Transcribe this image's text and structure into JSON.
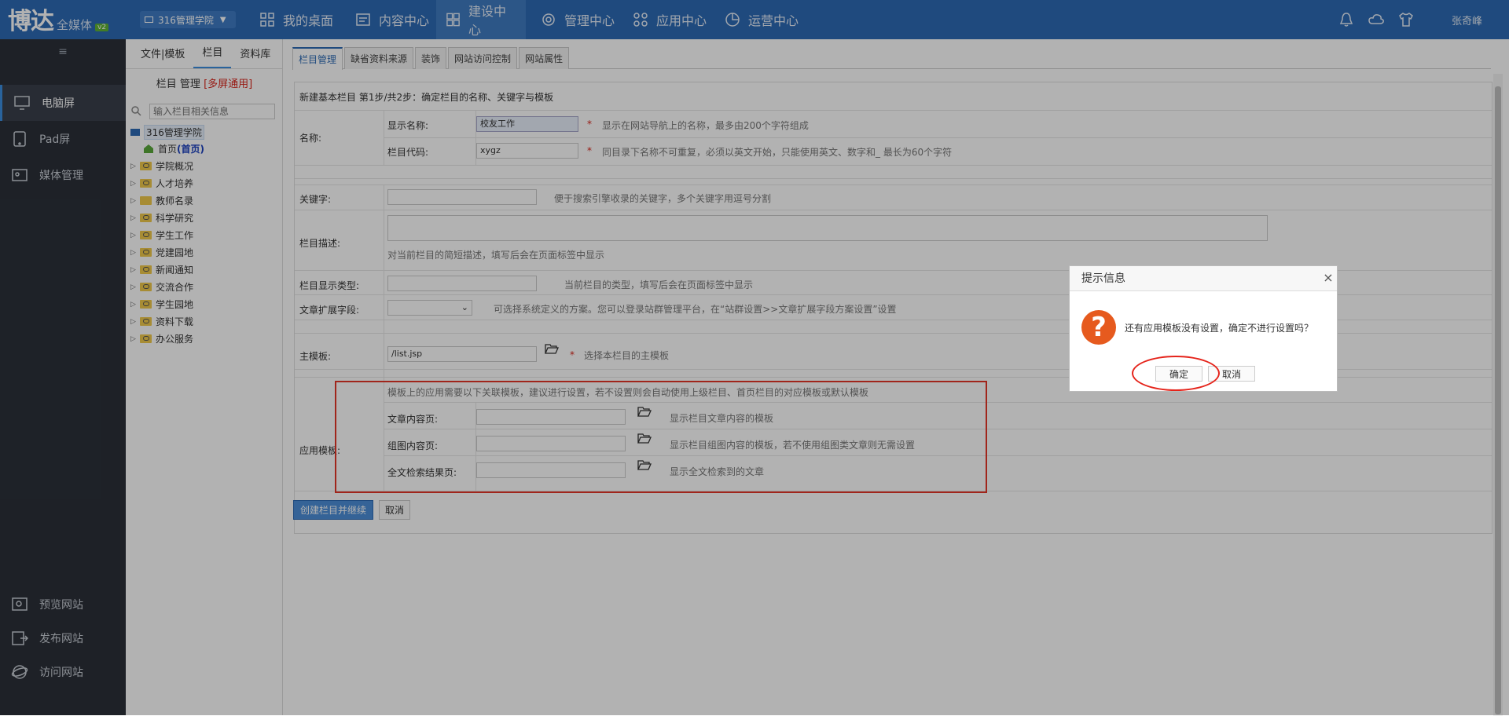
{
  "header": {
    "logo_main": "博达",
    "logo_sub": "全媒体",
    "logo_ver": "v2",
    "site_selector": "316管理学院",
    "nav": [
      "我的桌面",
      "内容中心",
      "建设中心",
      "管理中心",
      "应用中心",
      "运营中心"
    ],
    "active_nav": "建设中心",
    "user": "张奇峰"
  },
  "sidebar": {
    "items": [
      "电脑屏",
      "Pad屏",
      "媒体管理"
    ],
    "bottom": [
      "预览网站",
      "发布网站",
      "访问网站"
    ]
  },
  "tree": {
    "tabs": [
      "文件|模板",
      "栏目",
      "资料库"
    ],
    "title": "栏目 管理",
    "title_badge": "[多屏通用]",
    "search_placeholder": "输入栏目相关信息",
    "root": "316管理学院",
    "home": "首页",
    "home_tag": "(首页)",
    "nodes": [
      "学院概况",
      "人才培养",
      "教师名录",
      "科学研究",
      "学生工作",
      "党建园地",
      "新闻通知",
      "交流合作",
      "学生园地",
      "资料下载",
      "办公服务"
    ]
  },
  "main": {
    "tabs": [
      "栏目管理",
      "缺省资料来源",
      "装饰",
      "网站访问控制",
      "网站属性"
    ],
    "step_title": "新建基本栏目 第1步/共2步：确定栏目的名称、关键字与模板",
    "name_label": "名称:",
    "display_name_label": "显示名称:",
    "display_name_value": "校友工作",
    "display_name_hint": "显示在网站导航上的名称，最多由200个字符组成",
    "code_label": "栏目代码:",
    "code_value": "xygz",
    "code_hint": "同目录下名称不可重复，必须以英文开始，只能使用英文、数字和_ 最长为60个字符",
    "keyword_label": "关键字:",
    "keyword_hint": "便于搜索引擎收录的关键字，多个关键字用逗号分割",
    "desc_label": "栏目描述:",
    "desc_hint": "对当前栏目的简短描述，填写后会在页面标签中显示",
    "type_label": "栏目显示类型:",
    "type_hint": "当前栏目的类型，填写后会在页面标签中显示",
    "ext_label": "文章扩展字段:",
    "ext_hint": "可选择系统定义的方案。您可以登录站群管理平台，在“站群设置>>文章扩展字段方案设置”设置",
    "tpl_label": "主模板:",
    "tpl_value": "/list.jsp",
    "tpl_hint": "选择本栏目的主模板",
    "app_label": "应用模板:",
    "app_note": "模板上的应用需要以下关联模板，建议进行设置，若不设置则会自动使用上级栏目、首页栏目的对应模板或默认模板",
    "article_label": "文章内容页:",
    "article_hint": "显示栏目文章内容的模板",
    "gallery_label": "组图内容页:",
    "gallery_hint": "显示栏目组图内容的模板，若不使用组图类文章则无需设置",
    "search_label": "全文检索结果页:",
    "search_hint": "显示全文检索到的文章",
    "create_btn": "创建栏目并继续",
    "cancel_btn": "取消",
    "star": "*"
  },
  "dialog": {
    "title": "提示信息",
    "message": "还有应用模板没有设置，确定不进行设置吗？",
    "ok": "确定",
    "cancel": "取消",
    "icon": "?",
    "close": "×"
  }
}
